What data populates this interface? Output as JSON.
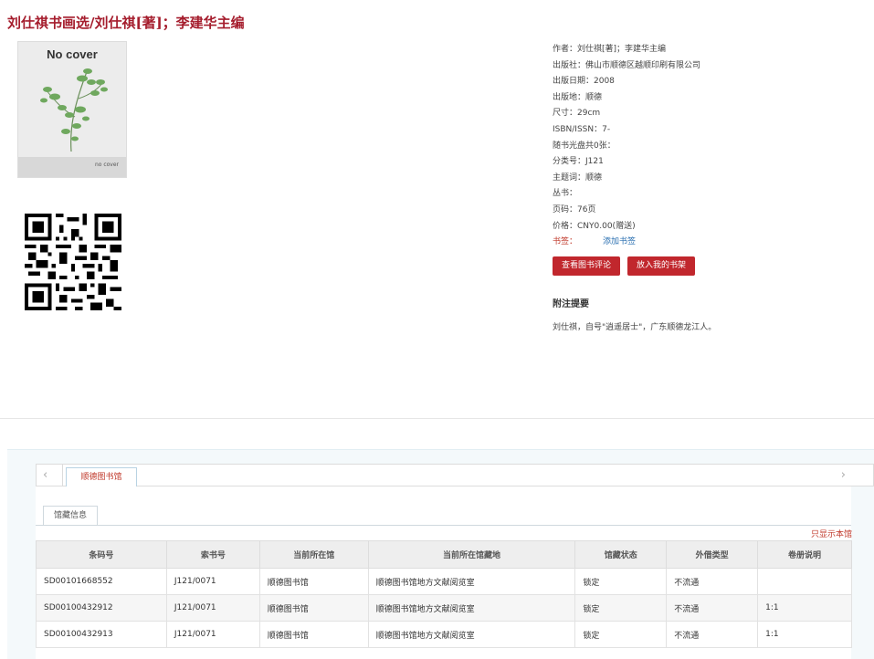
{
  "page": {
    "title": "刘仕祺书画选/刘仕祺[著]；李建华主编"
  },
  "cover": {
    "title": "No cover",
    "footer": "no cover"
  },
  "meta": {
    "author": "作者：刘仕祺[著]；李建华主编",
    "publisher": "出版社：佛山市顺德区越顺印刷有限公司",
    "pubdate": "出版日期：2008",
    "pubplace": "出版地：顺德",
    "size": "尺寸：29cm",
    "isbn": "ISBN/ISSN：7-",
    "disc": "随书光盘共0张：",
    "classno": "分类号：J121",
    "subject": "主题词：顺德",
    "series": "丛书：",
    "pages": "页码：76页",
    "price": "价格：CNY0.00(赠送)",
    "bookmark_label": "书签：",
    "bookmark_add": "添加书签"
  },
  "buttons": {
    "reviews": "查看图书评论",
    "shelf": "放入我的书架"
  },
  "note": {
    "heading": "附注提要",
    "text": "刘仕祺，自号\"逍遥居士\"，广东顺德龙江人。"
  },
  "tabs": {
    "library": "顺德图书馆",
    "holdings": "馆藏信息",
    "only_this": "只显示本馆"
  },
  "table": {
    "headers": [
      "条码号",
      "索书号",
      "当前所在馆",
      "当前所在馆藏地",
      "馆藏状态",
      "外借类型",
      "卷册说明"
    ],
    "rows": [
      [
        "SD00101668552",
        "J121/0071",
        "顺德图书馆",
        "顺德图书馆地方文献阅览室",
        "锁定",
        "不流通",
        ""
      ],
      [
        "SD00100432912",
        "J121/0071",
        "顺德图书馆",
        "顺德图书馆地方文献阅览室",
        "锁定",
        "不流通",
        "1:1"
      ],
      [
        "SD00100432913",
        "J121/0071",
        "顺德图书馆",
        "顺德图书馆地方文献阅览室",
        "锁定",
        "不流通",
        "1:1"
      ]
    ]
  },
  "colors": {
    "accent": "#a51d2d",
    "button": "#c1272d",
    "link": "#2a6fb0"
  }
}
